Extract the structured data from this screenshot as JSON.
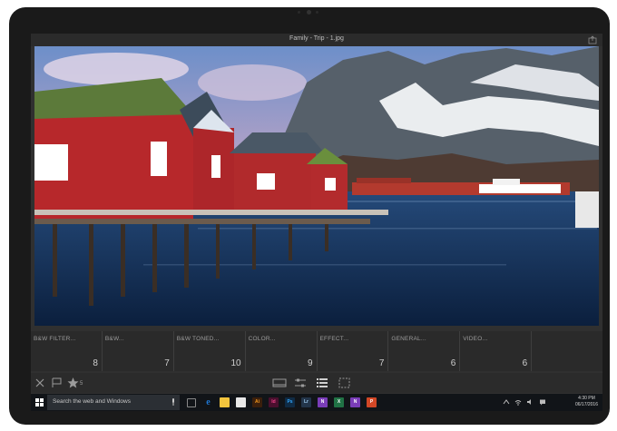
{
  "window": {
    "title": "Family - Trip - 1.jpg"
  },
  "presets": [
    {
      "label": "B&W FILTER...",
      "count": "8"
    },
    {
      "label": "B&W...",
      "count": "7"
    },
    {
      "label": "B&W TONED...",
      "count": "10"
    },
    {
      "label": "COLOR...",
      "count": "9"
    },
    {
      "label": "EFFECT...",
      "count": "7"
    },
    {
      "label": "GENERAL...",
      "count": "6"
    },
    {
      "label": "VIDEO...",
      "count": "6"
    },
    {
      "label": "",
      "count": ""
    }
  ],
  "toolbar": {
    "rating_count": "5"
  },
  "taskbar": {
    "search_placeholder": "Search the web and Windows",
    "apps": [
      {
        "name": "task-view-icon",
        "label": "",
        "color": "#2b2f34"
      },
      {
        "name": "edge-icon",
        "label": "e",
        "color": "#1e78d6"
      },
      {
        "name": "file-explorer-icon",
        "label": "",
        "color": "#f2c43d"
      },
      {
        "name": "store-icon",
        "label": "",
        "color": "#e8e8e8"
      },
      {
        "name": "illustrator-icon",
        "label": "Ai",
        "color": "#3b1f0c"
      },
      {
        "name": "indesign-icon",
        "label": "Id",
        "color": "#4a0f2e"
      },
      {
        "name": "photoshop-icon",
        "label": "Ps",
        "color": "#0f2b45"
      },
      {
        "name": "lightroom-icon",
        "label": "Lr",
        "color": "#23354a"
      },
      {
        "name": "onenote-icon",
        "label": "N",
        "color": "#7a3db8"
      },
      {
        "name": "excel-icon",
        "label": "X",
        "color": "#207245"
      },
      {
        "name": "onenote2-icon",
        "label": "N",
        "color": "#7a3db8"
      },
      {
        "name": "powerpoint-icon",
        "label": "P",
        "color": "#d24726"
      }
    ],
    "time": "4:30 PM",
    "date": "06/17/2016"
  }
}
